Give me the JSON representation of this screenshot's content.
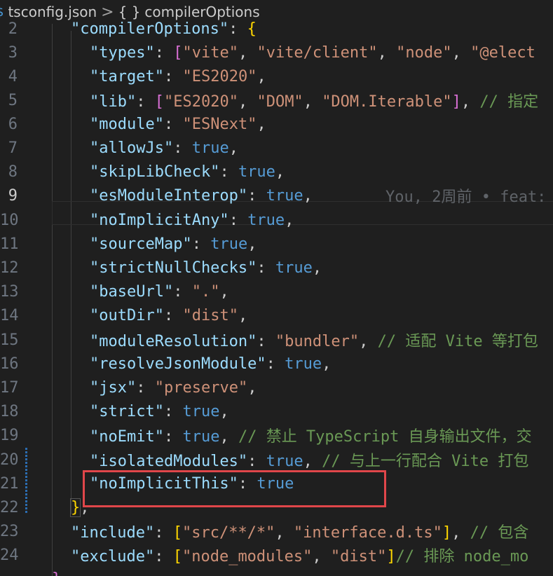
{
  "breadcrumb": {
    "file_icon": "$",
    "file": "tsconfig.json",
    "separator": ">",
    "braces": "{ }",
    "section": "compilerOptions"
  },
  "lines": [
    {
      "n": "2",
      "text": "\"compilerOptions\": {"
    },
    {
      "n": "3",
      "text": "\"types\": [\"vite\", \"vite/client\", \"node\", \"@elect"
    },
    {
      "n": "4",
      "text": "\"target\": \"ES2020\","
    },
    {
      "n": "5",
      "text": "\"lib\": [\"ES2020\", \"DOM\", \"DOM.Iterable\"], // 指定"
    },
    {
      "n": "6",
      "text": "\"module\": \"ESNext\","
    },
    {
      "n": "7",
      "text": "\"allowJs\": true,"
    },
    {
      "n": "8",
      "text": "\"skipLibCheck\": true,"
    },
    {
      "n": "9",
      "text": "\"esModuleInterop\": true,",
      "blame": "You, 2周前 • feat:"
    },
    {
      "n": "10",
      "text": "\"noImplicitAny\": true,"
    },
    {
      "n": "11",
      "text": "\"sourceMap\": true,"
    },
    {
      "n": "12",
      "text": "\"strictNullChecks\": true,"
    },
    {
      "n": "13",
      "text": "\"baseUrl\": \".\","
    },
    {
      "n": "14",
      "text": "\"outDir\": \"dist\","
    },
    {
      "n": "15",
      "text": "\"moduleResolution\": \"bundler\", // 适配 Vite 等打包"
    },
    {
      "n": "16",
      "text": "\"resolveJsonModule\": true,"
    },
    {
      "n": "17",
      "text": "\"jsx\": \"preserve\","
    },
    {
      "n": "18",
      "text": "\"strict\": true,"
    },
    {
      "n": "19",
      "text": "\"noEmit\": true, // 禁止 TypeScript 自身输出文件，交"
    },
    {
      "n": "20",
      "text": "\"isolatedModules\": true, // 与上一行配合 Vite 打包"
    },
    {
      "n": "21",
      "text": "\"noImplicitThis\": true"
    },
    {
      "n": "22",
      "text": "},"
    },
    {
      "n": "23",
      "text": "\"include\": [\"src/**/*\", \"interface.d.ts\"], // 包含"
    },
    {
      "n": "24",
      "text": "\"exclude\": [\"node_modules\", \"dist\"]// 排除 node_mo"
    }
  ],
  "colors": {
    "background": "#1f1f1f",
    "key": "#9cdcfe",
    "string": "#ce9178",
    "keyword": "#569cd6",
    "comment": "#6a9955",
    "highlight_border": "#e0464a"
  }
}
